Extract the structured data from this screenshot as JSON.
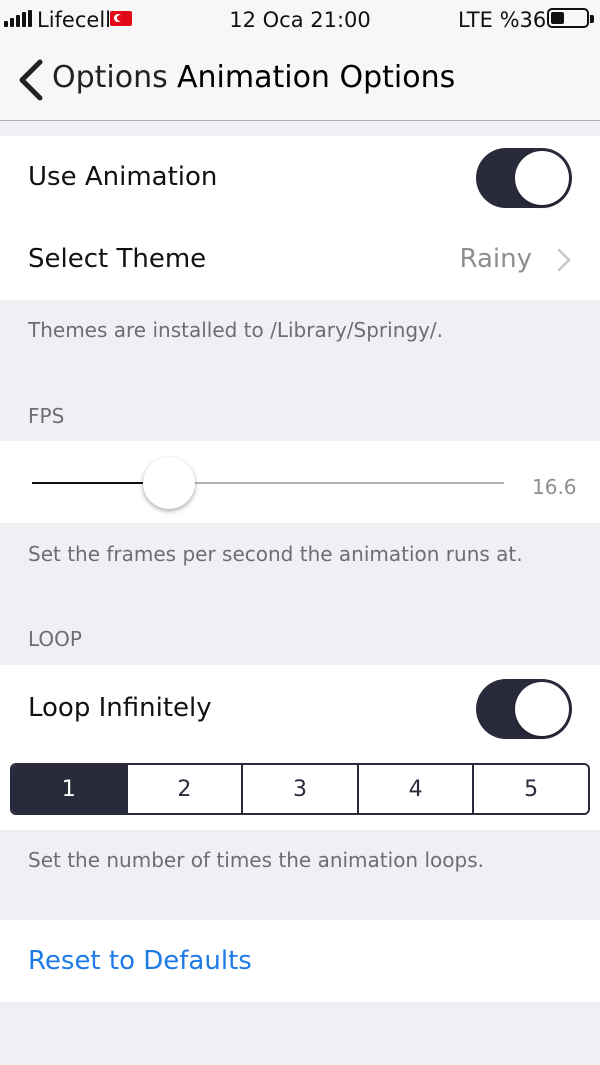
{
  "status_bar": {
    "carrier": "Lifecell",
    "time": "12 Oca 21:00",
    "network": "LTE %36",
    "battery_level": 0.3
  },
  "nav": {
    "back_label": "Options",
    "title": "Animation Options"
  },
  "animation": {
    "use_animation_label": "Use Animation",
    "use_animation_on": true,
    "select_theme_label": "Select Theme",
    "theme_value": "Rainy",
    "themes_footer": "Themes are installed to /Library/Springy/."
  },
  "fps": {
    "header": "FPS",
    "value": "16.6",
    "slider_fraction": 0.29,
    "footer": "Set the frames per second the animation runs at."
  },
  "loop": {
    "header": "LOOP",
    "infinite_label": "Loop Infinitely",
    "infinite_on": true,
    "segments": [
      "1",
      "2",
      "3",
      "4",
      "5"
    ],
    "selected_segment": "1",
    "footer": "Set the number of times the animation loops."
  },
  "reset": {
    "label": "Reset to Defaults"
  },
  "colors": {
    "accent_dark": "#2a2a3d",
    "link_blue": "#1e7ae6",
    "background": "#efeff4"
  }
}
